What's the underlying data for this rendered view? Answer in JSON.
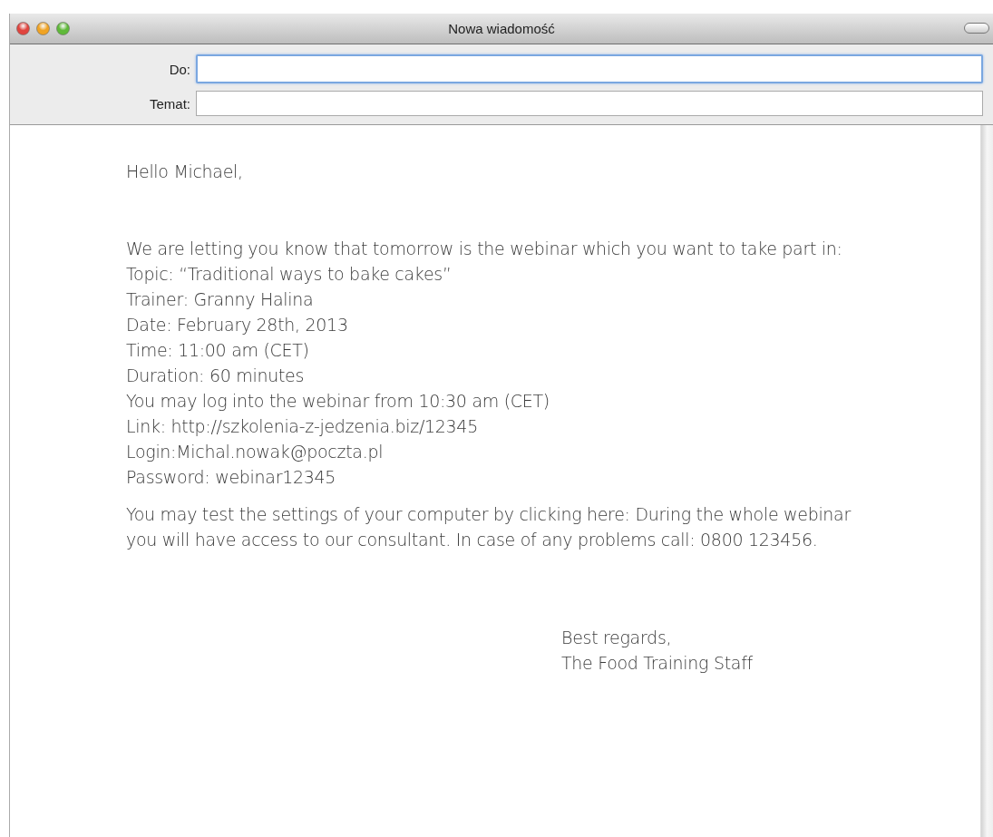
{
  "window": {
    "title": "Nowa wiadomość"
  },
  "fields": [
    {
      "label": "Do:",
      "focused": true
    },
    {
      "label": "Temat:",
      "focused": false
    }
  ],
  "message": {
    "greeting": "Hello Michael,",
    "intro": "We are letting you know that tomorrow is the webinar which you want to take part in:",
    "details": [
      "Topic: “Traditional ways to bake cakes”",
      "Trainer: Granny Halina",
      "Date: February 28th, 2013",
      "Time: 11:00 am (CET)",
      "Duration: 60 minutes",
      "You may log into the webinar from 10:30 am (CET)",
      "Link: http://szkolenia-z-jedzenia.biz/12345",
      "Login:Michal.nowak@poczta.pl",
      "Password:  webinar12345"
    ],
    "closing": "You may test the settings of your computer by clicking here: During the whole webinar you will have access to our consultant. In case of any problems call: 0800 123456.",
    "signature": [
      "Best regards,",
      "The Food Training Staff"
    ]
  }
}
